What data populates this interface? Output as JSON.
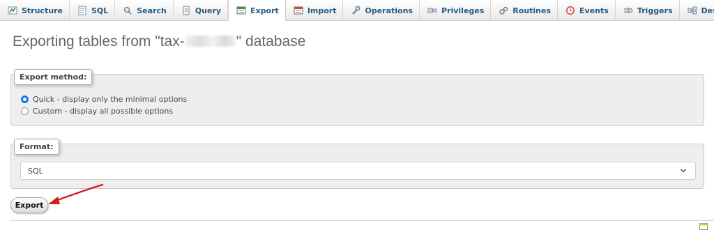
{
  "tabs": [
    {
      "id": "structure",
      "label": "Structure",
      "icon": "structure-icon",
      "active": false
    },
    {
      "id": "sql",
      "label": "SQL",
      "icon": "sql-icon",
      "active": false
    },
    {
      "id": "search",
      "label": "Search",
      "icon": "search-icon",
      "active": false
    },
    {
      "id": "query",
      "label": "Query",
      "icon": "query-icon",
      "active": false
    },
    {
      "id": "export",
      "label": "Export",
      "icon": "export-icon",
      "active": true
    },
    {
      "id": "import",
      "label": "Import",
      "icon": "import-icon",
      "active": false
    },
    {
      "id": "operations",
      "label": "Operations",
      "icon": "wrench-icon",
      "active": false
    },
    {
      "id": "privileges",
      "label": "Privileges",
      "icon": "privileges-icon",
      "active": false
    },
    {
      "id": "routines",
      "label": "Routines",
      "icon": "routines-icon",
      "active": false
    },
    {
      "id": "events",
      "label": "Events",
      "icon": "clock-icon",
      "active": false
    },
    {
      "id": "triggers",
      "label": "Triggers",
      "icon": "triggers-icon",
      "active": false
    },
    {
      "id": "designer",
      "label": "Designer",
      "icon": "designer-icon",
      "active": false
    }
  ],
  "page": {
    "title_prefix": "Exporting tables from \"tax-",
    "title_suffix": "\" database"
  },
  "export_method": {
    "legend": "Export method:",
    "options": [
      {
        "label": "Quick - display only the minimal options",
        "selected": true
      },
      {
        "label": "Custom - display all possible options",
        "selected": false
      }
    ]
  },
  "format": {
    "legend": "Format:",
    "selected": "SQL"
  },
  "actions": {
    "export_label": "Export"
  },
  "colors": {
    "tab_text": "#235a81",
    "radio_accent": "#1a73e8",
    "annotation_arrow": "#d81b1b",
    "panel_bg": "#eeeeee"
  }
}
